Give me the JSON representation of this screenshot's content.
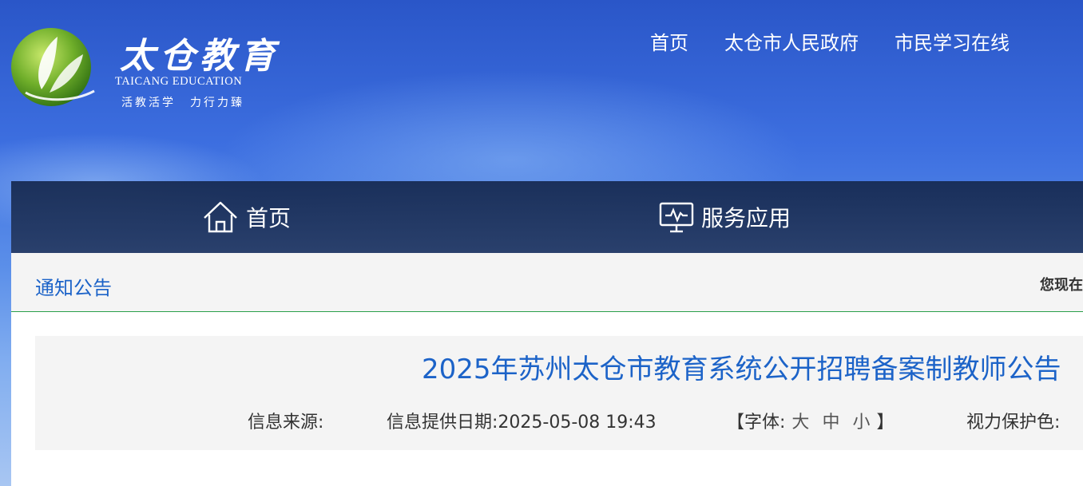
{
  "header": {
    "logo_title": "太仓教育",
    "logo_en": "TAICANG EDUCATION",
    "slogan_left": "活教活学",
    "slogan_right": "力行力臻",
    "top_links": [
      "首页",
      "太仓市人民政府",
      "市民学习在线"
    ]
  },
  "nav": {
    "home_label": "首页",
    "home_icon": "home-icon",
    "service_label": "服务应用",
    "service_icon": "monitor-icon"
  },
  "breadcrumb": {
    "section_title": "通知公告",
    "location_label": "您现在"
  },
  "article": {
    "title": "2025年苏州太仓市教育系统公开招聘备案制教师公告",
    "source_label": "信息来源:",
    "date_label": "信息提供日期:",
    "date_value": "2025-05-08 19:43",
    "font_open": "【字体:",
    "font_large": "大",
    "font_medium": "中",
    "font_small": "小",
    "font_close": "】",
    "eye_care_label": "视力保护色:"
  },
  "colors": {
    "link_blue": "#1c63c8",
    "nav_dark": "#1f3a6e",
    "divider_green": "#2aa04a"
  }
}
